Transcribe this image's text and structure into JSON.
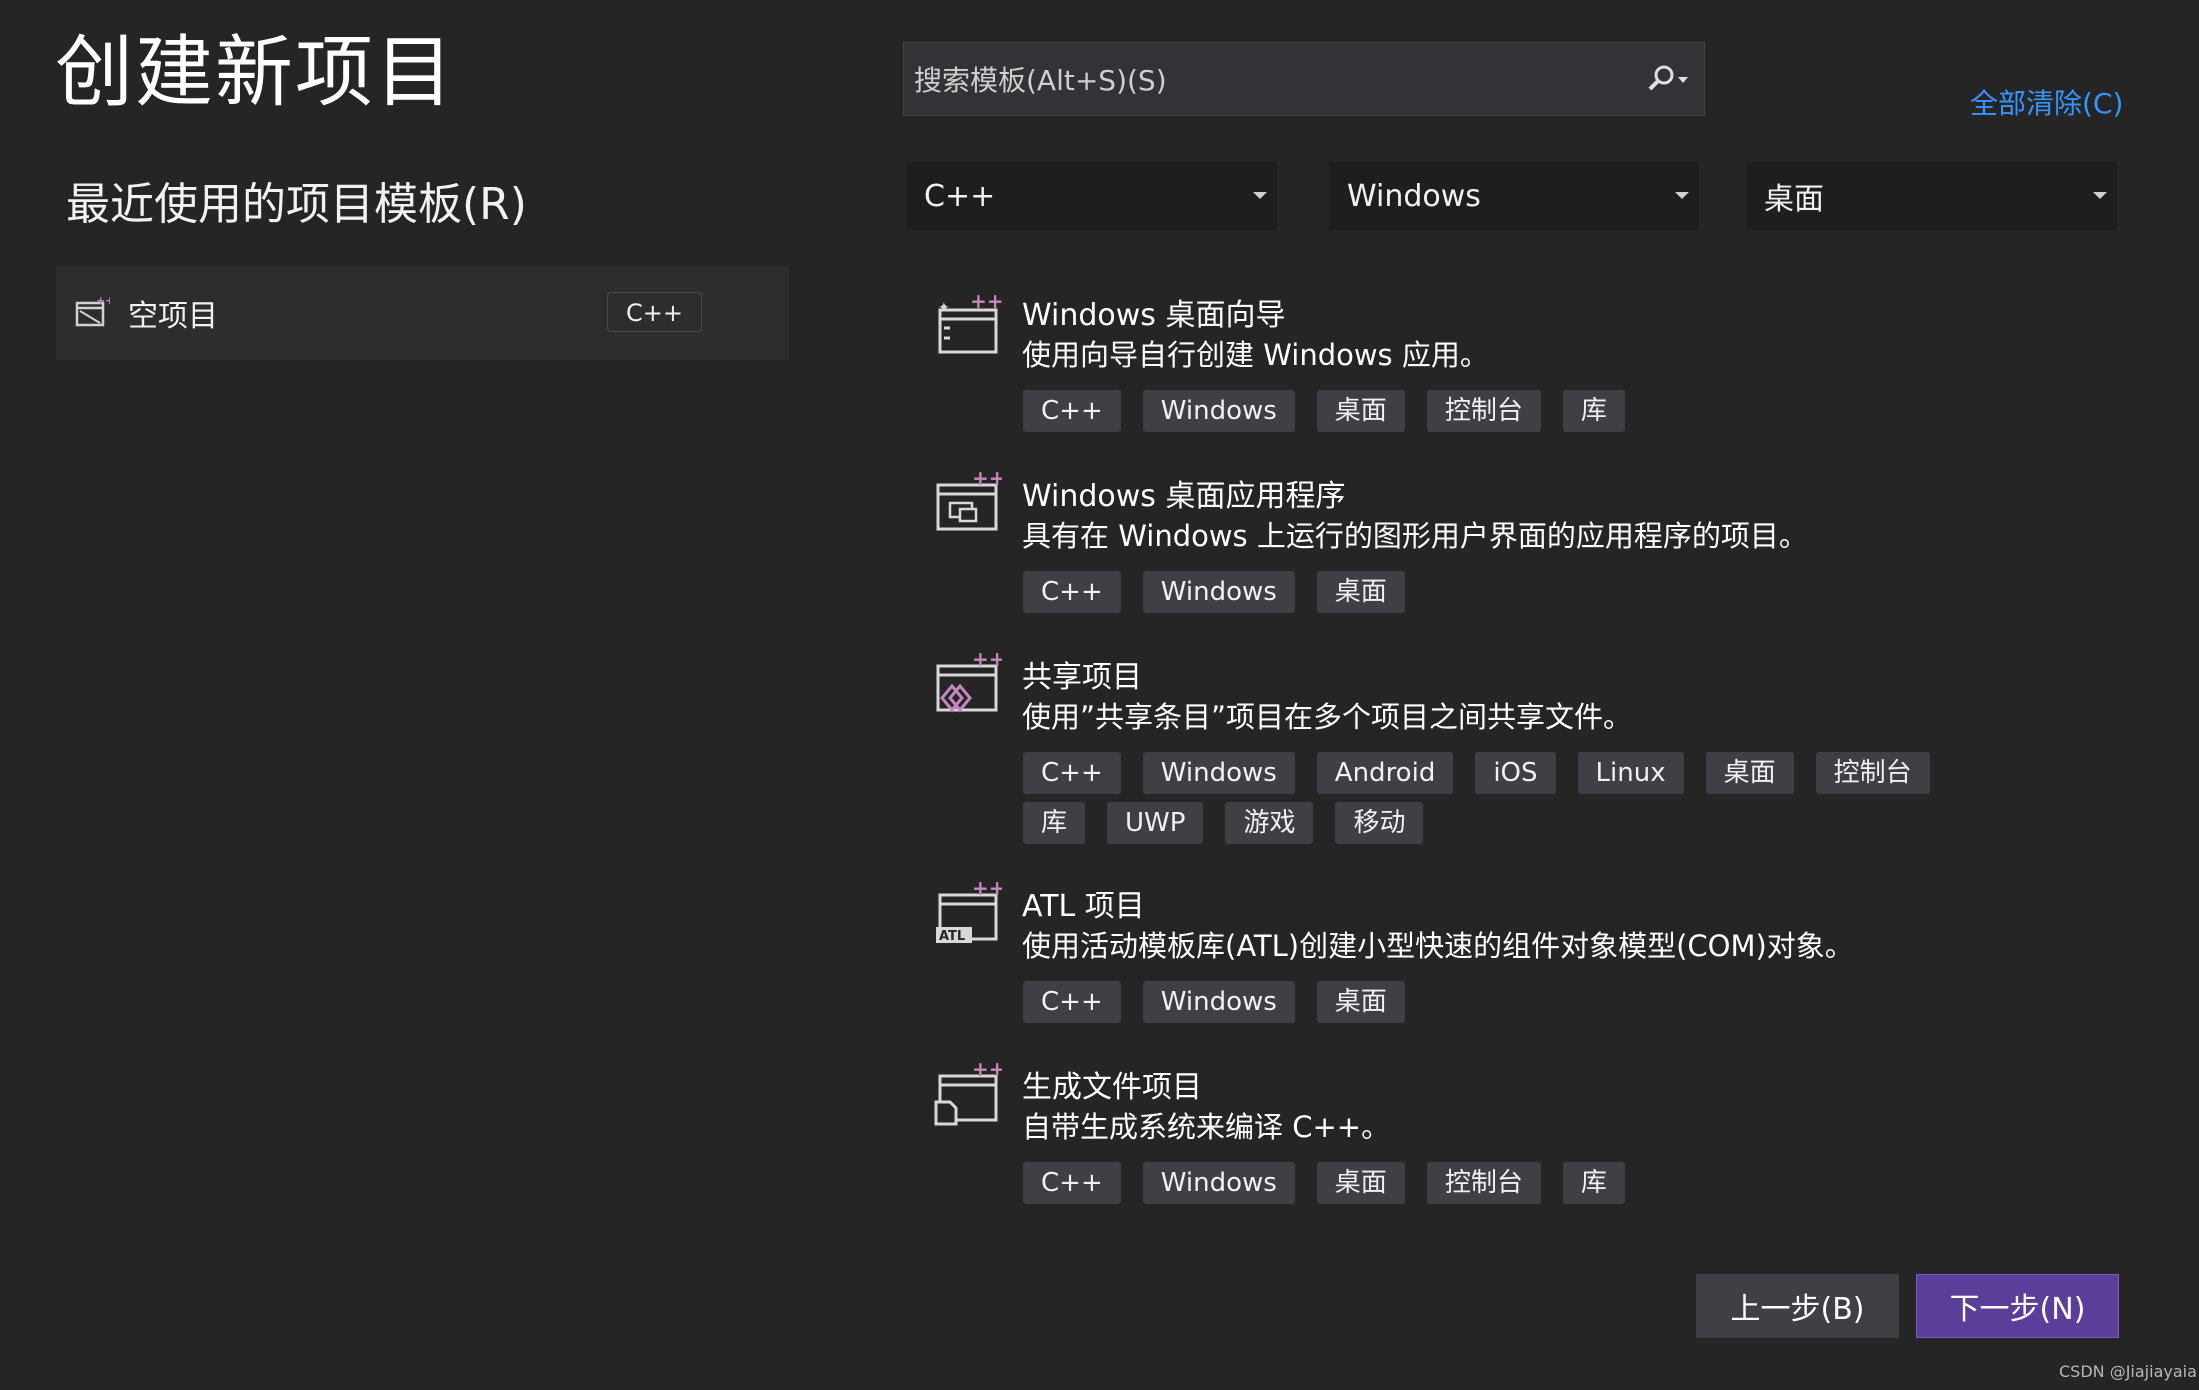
{
  "page": {
    "title": "创建新项目"
  },
  "recent": {
    "heading": "最近使用的项目模板(R)",
    "items": [
      {
        "label": "空项目",
        "tag": "C++",
        "icon": "empty-project-icon"
      }
    ]
  },
  "search": {
    "placeholder": "搜索模板(Alt+S)(S)",
    "value": "",
    "icon": "search-icon"
  },
  "clear_all": "全部清除(C)",
  "filters": {
    "language": "C++",
    "platform": "Windows",
    "project_type": "桌面"
  },
  "templates": [
    {
      "name": "Windows 桌面向导",
      "desc": "使用向导自行创建 Windows 应用。",
      "icon": "desktop-wizard-icon",
      "tags": [
        "C++",
        "Windows",
        "桌面",
        "控制台",
        "库"
      ]
    },
    {
      "name": "Windows 桌面应用程序",
      "desc": "具有在 Windows 上运行的图形用户界面的应用程序的项目。",
      "icon": "desktop-app-icon",
      "tags": [
        "C++",
        "Windows",
        "桌面"
      ]
    },
    {
      "name": "共享项目",
      "desc": "使用”共享条目”项目在多个项目之间共享文件。",
      "icon": "shared-project-icon",
      "tags": [
        "C++",
        "Windows",
        "Android",
        "iOS",
        "Linux",
        "桌面",
        "控制台",
        "库",
        "UWP",
        "游戏",
        "移动"
      ]
    },
    {
      "name": "ATL 项目",
      "desc": "使用活动模板库(ATL)创建小型快速的组件对象模型(COM)对象。",
      "icon": "atl-project-icon",
      "tags": [
        "C++",
        "Windows",
        "桌面"
      ]
    },
    {
      "name": "生成文件项目",
      "desc": "自带生成系统来编译 C++。",
      "icon": "makefile-project-icon",
      "tags": [
        "C++",
        "Windows",
        "桌面",
        "控制台",
        "库"
      ]
    }
  ],
  "buttons": {
    "back": "上一步(B)",
    "next": "下一步(N)"
  },
  "watermark": "CSDN @Jiajiayaia",
  "colors": {
    "background": "#252526",
    "link": "#3794ff",
    "primary_button": "#5b3e99",
    "tag_bg": "#3f3f46",
    "icon_accent": "#c586c0"
  }
}
